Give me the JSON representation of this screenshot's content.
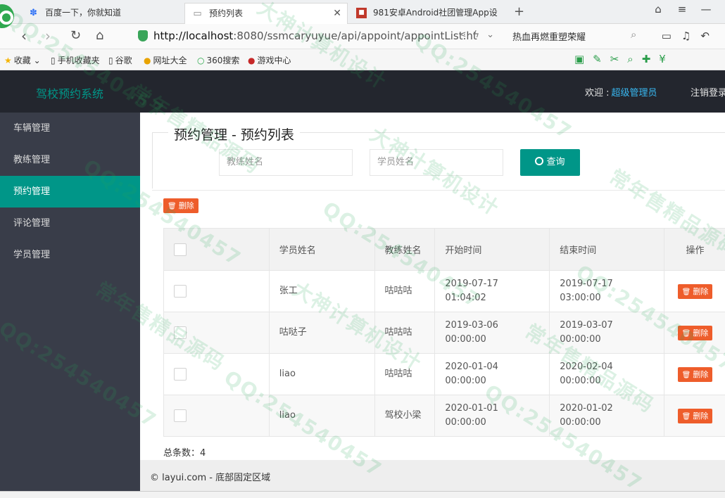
{
  "browser": {
    "tabs": [
      {
        "label": "百度一下，你就知道",
        "icon": "paw-icon"
      },
      {
        "label": "预约列表",
        "icon": "page-icon"
      },
      {
        "label": "981安卓Android社团管理App设",
        "icon": "favicon-icon"
      }
    ],
    "url_host": "http://localhost",
    "url_path": ":8080/ssmcaryuyue/api/appoint/appointList.ht",
    "search_text": "热血再燃重塑荣耀",
    "bookmarks": [
      "收藏",
      "手机收藏夹",
      "谷歌",
      "网址大全",
      "360搜索",
      "游戏中心"
    ]
  },
  "header": {
    "logo": "驾校预约系统",
    "welcome_label": "欢迎 :",
    "user_name": "超级管理员",
    "logout": "注销登录"
  },
  "sidebar": {
    "items": [
      {
        "label": "车辆管理",
        "active": false
      },
      {
        "label": "教练管理",
        "active": false
      },
      {
        "label": "预约管理",
        "active": true
      },
      {
        "label": "评论管理",
        "active": false
      },
      {
        "label": "学员管理",
        "active": false
      }
    ]
  },
  "main": {
    "title": "预约管理 - 预约列表",
    "coach_placeholder": "教练姓名",
    "student_placeholder": "学员姓名",
    "search_label": "查询",
    "batch_delete_label": "删除",
    "columns": [
      "学员姓名",
      "教练姓名",
      "开始时间",
      "结束时间",
      "操作"
    ],
    "rows": [
      {
        "student": "张工",
        "coach": "咕咕咕",
        "start_date": "2019-07-17",
        "start_time": "01:04:02",
        "end_date": "2019-07-17",
        "end_time": "03:00:00",
        "action": "删除"
      },
      {
        "student": "咕哒子",
        "coach": "咕咕咕",
        "start_date": "2019-03-06",
        "start_time": "00:00:00",
        "end_date": "2019-03-07",
        "end_time": "00:00:00",
        "action": "删除"
      },
      {
        "student": "liao",
        "coach": "咕咕咕",
        "start_date": "2020-01-04",
        "start_time": "00:00:00",
        "end_date": "2020-02-04",
        "end_time": "00:00:00",
        "action": "删除"
      },
      {
        "student": "liao",
        "coach": "驾校小梁",
        "start_date": "2020-01-01",
        "start_time": "00:00:00",
        "end_date": "2020-01-02",
        "end_time": "00:00:00",
        "action": "删除"
      }
    ],
    "total_label": "总条数：4"
  },
  "footer": {
    "text": "© layui.com - 底部固定区域"
  },
  "watermarks": [
    "QQ:254540457",
    "大神计算机设计",
    "常年售精品源码"
  ],
  "colors": {
    "header_bg": "#23262e",
    "sidebar_bg": "#393d49",
    "accent": "#009688",
    "danger": "#ee5d2b",
    "user_link": "#38b8f2"
  }
}
